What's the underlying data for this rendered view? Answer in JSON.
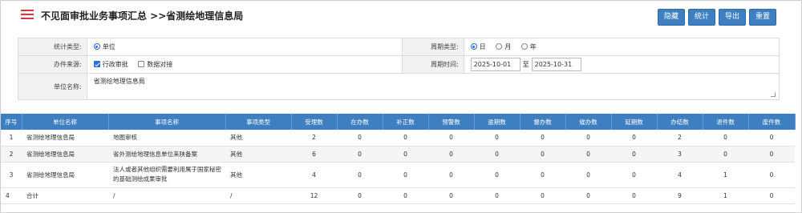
{
  "header": {
    "title": "不见面审批业务事项汇总 >>省测绘地理信息局",
    "buttons": [
      "隐藏",
      "统计",
      "导出",
      "重置"
    ]
  },
  "form": {
    "stat_type_label": "统计类型:",
    "stat_type_option": "单位",
    "period_type_label": "周期类型:",
    "period_options": [
      "日",
      "月",
      "年"
    ],
    "source_label": "办件来源:",
    "source_options": [
      "行政审批",
      "数据对接"
    ],
    "period_time_label": "周期时间:",
    "date_from": "2025-10-01",
    "date_sep": "至",
    "date_to": "2025-10-31",
    "unit_label": "单位名称:",
    "unit_value": "省测绘地理信息局"
  },
  "table": {
    "headers": [
      "序号",
      "单位名称",
      "事项名称",
      "事项类型",
      "受理数",
      "在办数",
      "补正数",
      "预警数",
      "逾期数",
      "督办数",
      "催办数",
      "延期数",
      "办结数",
      "退件数",
      "废件数"
    ],
    "rows": [
      [
        "1",
        "省测绘地理信息局",
        "地图审核",
        "其他",
        "2",
        "0",
        "0",
        "0",
        "0",
        "0",
        "0",
        "0",
        "2",
        "0",
        "0"
      ],
      [
        "2",
        "省测绘地理信息局",
        "省外测绘地理信息单位来陕备案",
        "其他",
        "6",
        "0",
        "0",
        "0",
        "0",
        "0",
        "0",
        "0",
        "3",
        "0",
        "0"
      ],
      [
        "3",
        "省测绘地理信息局",
        "法人或者其他组织需要利用属于国家秘密的基础测绘成果审批",
        "其他",
        "4",
        "0",
        "0",
        "0",
        "0",
        "0",
        "0",
        "0",
        "4",
        "1",
        "0"
      ],
      [
        "4",
        "合计",
        "/",
        "/",
        "12",
        "0",
        "0",
        "0",
        "0",
        "0",
        "0",
        "0",
        "9",
        "1",
        "0"
      ]
    ]
  },
  "colors": {
    "accent": "#3d7fc1",
    "title_icon": "#d9363e"
  }
}
